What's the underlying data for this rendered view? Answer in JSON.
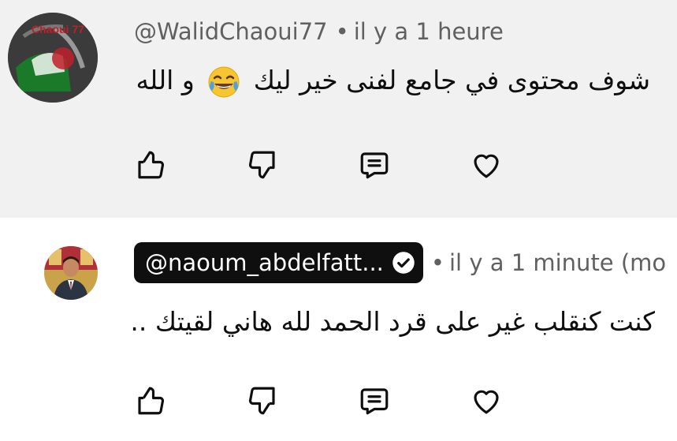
{
  "comments": [
    {
      "author": "@WalidChaoui77",
      "separator": "•",
      "time": "il y a 1 heure",
      "text_before_emoji": "شوف محتوى في جامع لفنى خير ليك",
      "emoji": "face-with-tears-of-joy",
      "text_after_emoji": "و الله",
      "avatar_label": "Chaoui 77",
      "verified": false
    },
    {
      "author": "@naoum_abdelfatt...",
      "separator": "•",
      "time": "il y a 1 minute (mo",
      "text": "كنت كنقلب غير على قرد الحمد لله هاني لقيتك ..",
      "verified": true
    }
  ],
  "actions": {
    "like": "thumbs-up-icon",
    "dislike": "thumbs-down-icon",
    "reply": "comment-icon",
    "heart": "heart-icon"
  },
  "colors": {
    "first_bg": "#f1f1f1",
    "second_bg": "#ffffff",
    "meta_text": "#606060",
    "pill_bg": "#0f0f0f"
  }
}
